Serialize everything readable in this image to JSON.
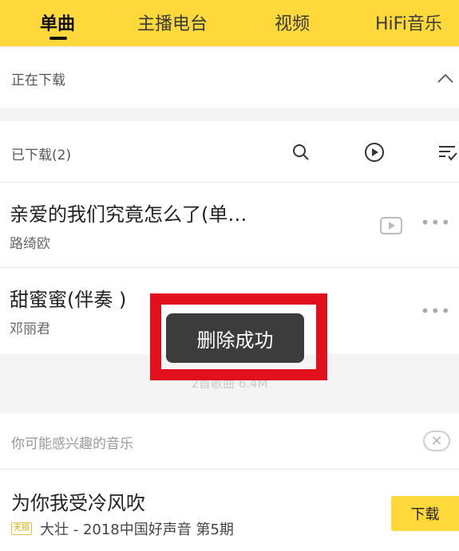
{
  "tabs": {
    "items": [
      "单曲",
      "主播电台",
      "视频",
      "HiFi音乐"
    ],
    "active": "单曲"
  },
  "downloading": {
    "label": "正在下载",
    "toggle_icon": "chevron-up-icon"
  },
  "downloaded": {
    "label": "已下载(2)",
    "icons": [
      "search-icon",
      "play-circle-icon",
      "sort-list-icon"
    ]
  },
  "songs": [
    {
      "title": "亲爱的我们究竟怎么了(单…",
      "artist": "路绮欧",
      "mv_icon": "video-icon"
    },
    {
      "title": "甜蜜蜜(伴奏 )",
      "artist": "邓丽君"
    }
  ],
  "toast": {
    "text": "删除成功"
  },
  "summary": {
    "text": "2首歌曲 6.4M"
  },
  "recommend": {
    "label": "你可能感兴趣的音乐",
    "close_icon": "close-icon",
    "item": {
      "title": "为你我受冷风吹",
      "badge": "无损",
      "subtitle": "大壮 - 2018中国好声音 第5期",
      "download_label": "下载"
    }
  },
  "colors": {
    "accent": "#ffd83a",
    "toast_bg": "#3c3c3c",
    "highlight_frame": "#e0101c"
  }
}
